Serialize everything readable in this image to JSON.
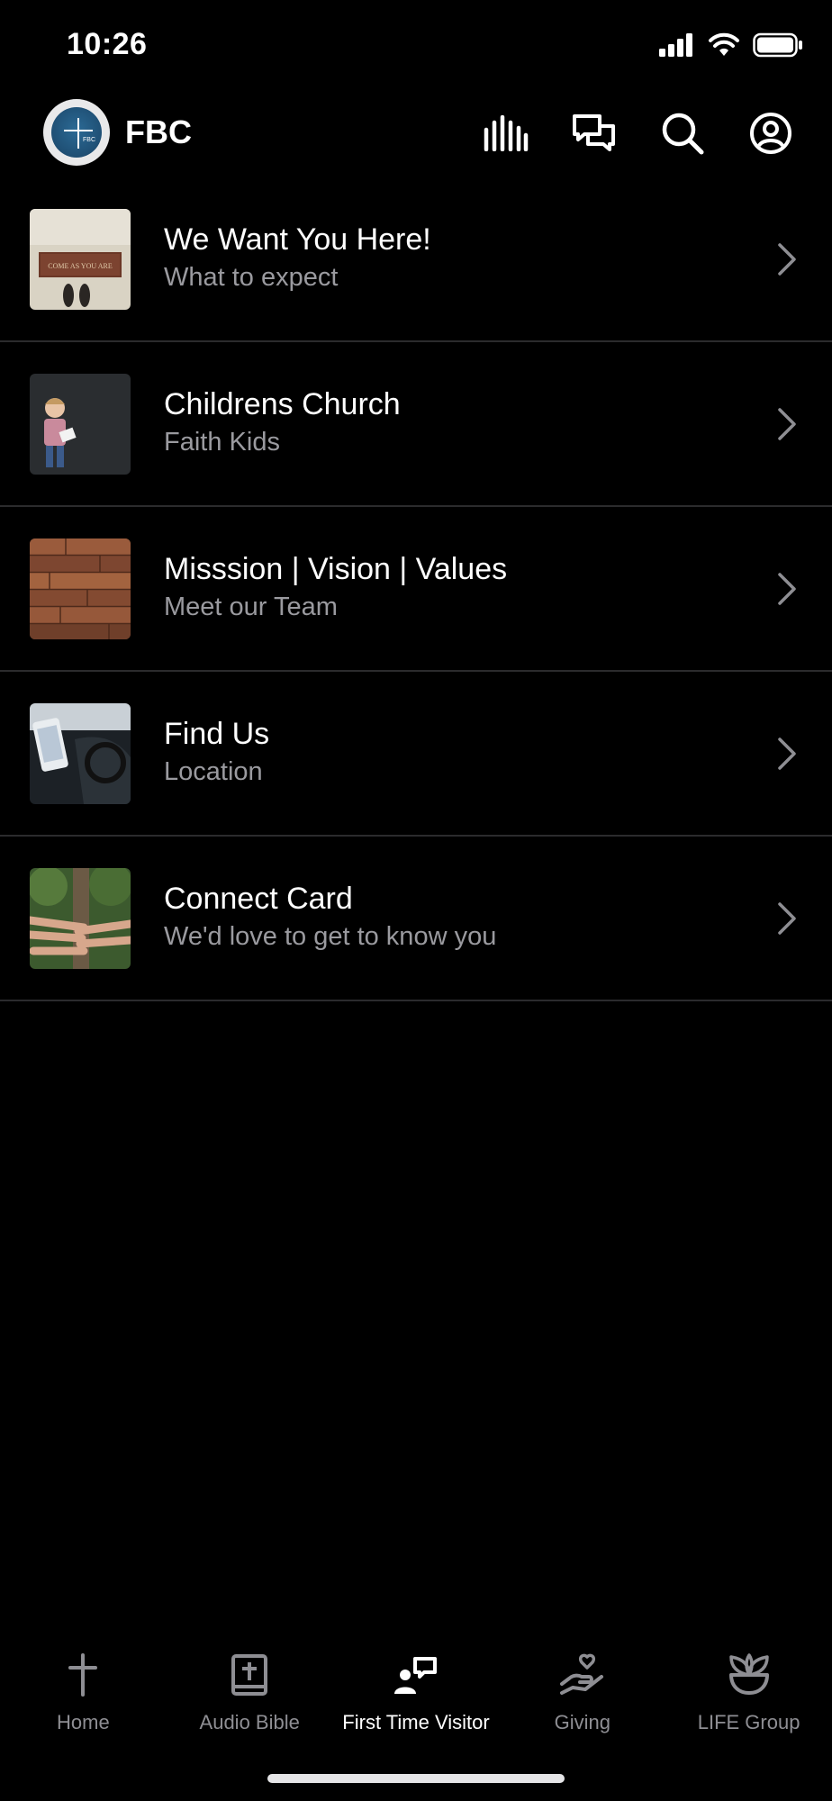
{
  "status_bar": {
    "time": "10:26",
    "icons": [
      "cellular-signal-icon",
      "wifi-icon",
      "battery-icon"
    ]
  },
  "header": {
    "brand_name": "FBC",
    "logo_text": "FBC",
    "actions": [
      "audio-bars-icon",
      "chat-icon",
      "search-icon",
      "profile-icon"
    ]
  },
  "list": {
    "items": [
      {
        "title": "We Want You Here!",
        "subtitle": "What to expect",
        "thumb": "doormat-come-as-you-are",
        "doormat_text": "COME AS YOU ARE"
      },
      {
        "title": "Childrens Church",
        "subtitle": "Faith Kids",
        "thumb": "child-with-book"
      },
      {
        "title": "Misssion | Vision | Values",
        "subtitle": "Meet our Team",
        "thumb": "wood-planks"
      },
      {
        "title": "Find Us",
        "subtitle": "Location",
        "thumb": "phone-in-car"
      },
      {
        "title": "Connect Card",
        "subtitle": "We'd love to get to know you",
        "thumb": "stacked-hands"
      }
    ]
  },
  "tab_bar": {
    "tabs": [
      {
        "label": "Home",
        "icon": "cross-icon",
        "active": false
      },
      {
        "label": "Audio Bible",
        "icon": "bible-icon",
        "active": false
      },
      {
        "label": "First Time Visitor",
        "icon": "visitor-icon",
        "active": true
      },
      {
        "label": "Giving",
        "icon": "giving-hand-icon",
        "active": false
      },
      {
        "label": "LIFE Group",
        "icon": "plant-icon",
        "active": false
      }
    ]
  },
  "colors": {
    "background": "#000000",
    "text_primary": "#ffffff",
    "text_secondary": "#9a9a9f",
    "divider": "#2b2b2d",
    "tab_inactive": "#8e8e93"
  }
}
